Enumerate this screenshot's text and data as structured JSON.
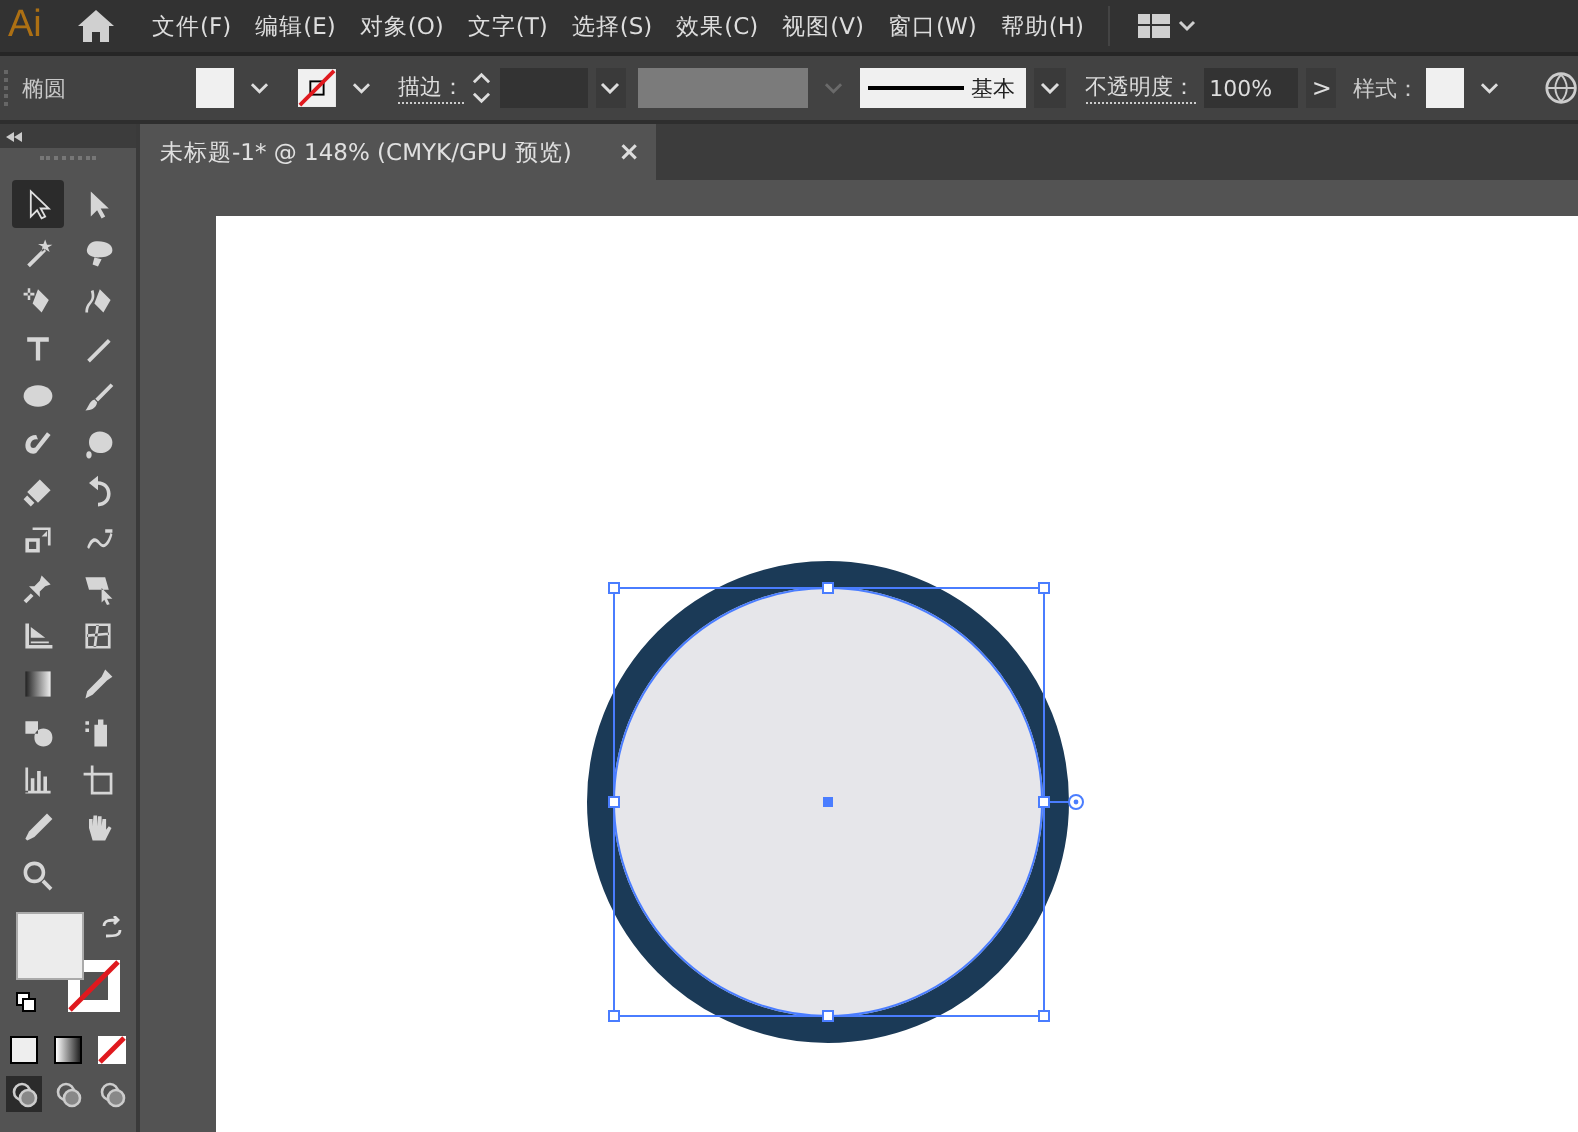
{
  "app": {
    "logo": "Ai"
  },
  "menu": [
    "文件(F)",
    "编辑(E)",
    "对象(O)",
    "文字(T)",
    "选择(S)",
    "效果(C)",
    "视图(V)",
    "窗口(W)",
    "帮助(H)"
  ],
  "control_bar": {
    "object_type": "椭圆",
    "stroke_label": "描边：",
    "stroke_profile": "基本",
    "opacity_label": "不透明度：",
    "opacity": "100%",
    "opacity_arrow": ">",
    "style_label": "样式："
  },
  "document_tab": {
    "title": "未标题-1* @ 148% (CMYK/GPU 预览)",
    "close": "×"
  },
  "tools": [
    {
      "kind": "selection",
      "selected": true
    },
    {
      "kind": "direct",
      "selected": false
    },
    {
      "kind": "wand",
      "selected": false
    },
    {
      "kind": "lasso",
      "selected": false
    },
    {
      "kind": "pen",
      "selected": false
    },
    {
      "kind": "curvature",
      "selected": false
    },
    {
      "kind": "type",
      "selected": false
    },
    {
      "kind": "line",
      "selected": false
    },
    {
      "kind": "ellipse",
      "selected": false
    },
    {
      "kind": "brush",
      "selected": false
    },
    {
      "kind": "shaper",
      "selected": false
    },
    {
      "kind": "blob",
      "selected": false
    },
    {
      "kind": "eraser",
      "selected": false
    },
    {
      "kind": "rotate",
      "selected": false
    },
    {
      "kind": "scale",
      "selected": false
    },
    {
      "kind": "warp",
      "selected": false
    },
    {
      "kind": "pin",
      "selected": false
    },
    {
      "kind": "transform",
      "selected": false
    },
    {
      "kind": "perspective",
      "selected": false
    },
    {
      "kind": "mesh",
      "selected": false
    },
    {
      "kind": "gradient",
      "selected": false
    },
    {
      "kind": "eyedropper",
      "selected": false
    },
    {
      "kind": "blend",
      "selected": false
    },
    {
      "kind": "sprayer",
      "selected": false
    },
    {
      "kind": "graph",
      "selected": false
    },
    {
      "kind": "artboard",
      "selected": false
    },
    {
      "kind": "slice",
      "selected": false
    },
    {
      "kind": "hand",
      "selected": false
    },
    {
      "kind": "zoom",
      "selected": false
    }
  ]
}
